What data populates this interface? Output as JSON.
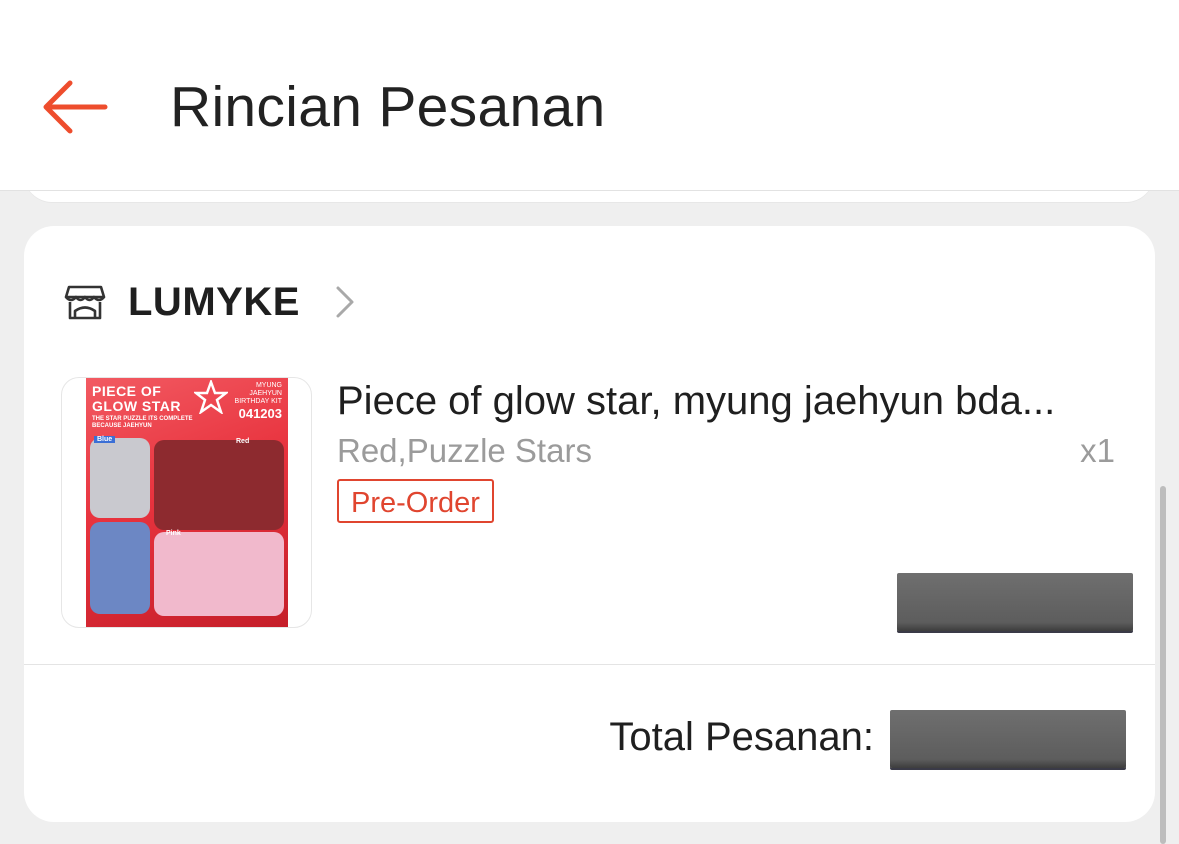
{
  "header": {
    "title": "Rincian Pesanan",
    "back_icon": "arrow-left-icon",
    "accent_color": "#ee4d2d"
  },
  "shop": {
    "icon": "store-icon",
    "name": "LUMYKE",
    "chevron_icon": "chevron-right-icon"
  },
  "product": {
    "name": "Piece of glow star, myung jaehyun bda...",
    "variant": "Red,Puzzle Stars",
    "quantity": "x1",
    "badge": "Pre-Order",
    "thumbnail": {
      "title_line1": "PIECE OF",
      "title_line2": "GLOW STAR",
      "subtitle": "THE STAR PUZZLE ITS COMPLETE BECAUSE JAEHYUN",
      "kit_text": "MYUNG JAEHYUN BIRTHDAY KIT",
      "code": "041203",
      "label_blue": "Blue",
      "label_red": "Red",
      "label_pink": "Pink"
    }
  },
  "summary": {
    "total_label": "Total Pesanan:"
  }
}
